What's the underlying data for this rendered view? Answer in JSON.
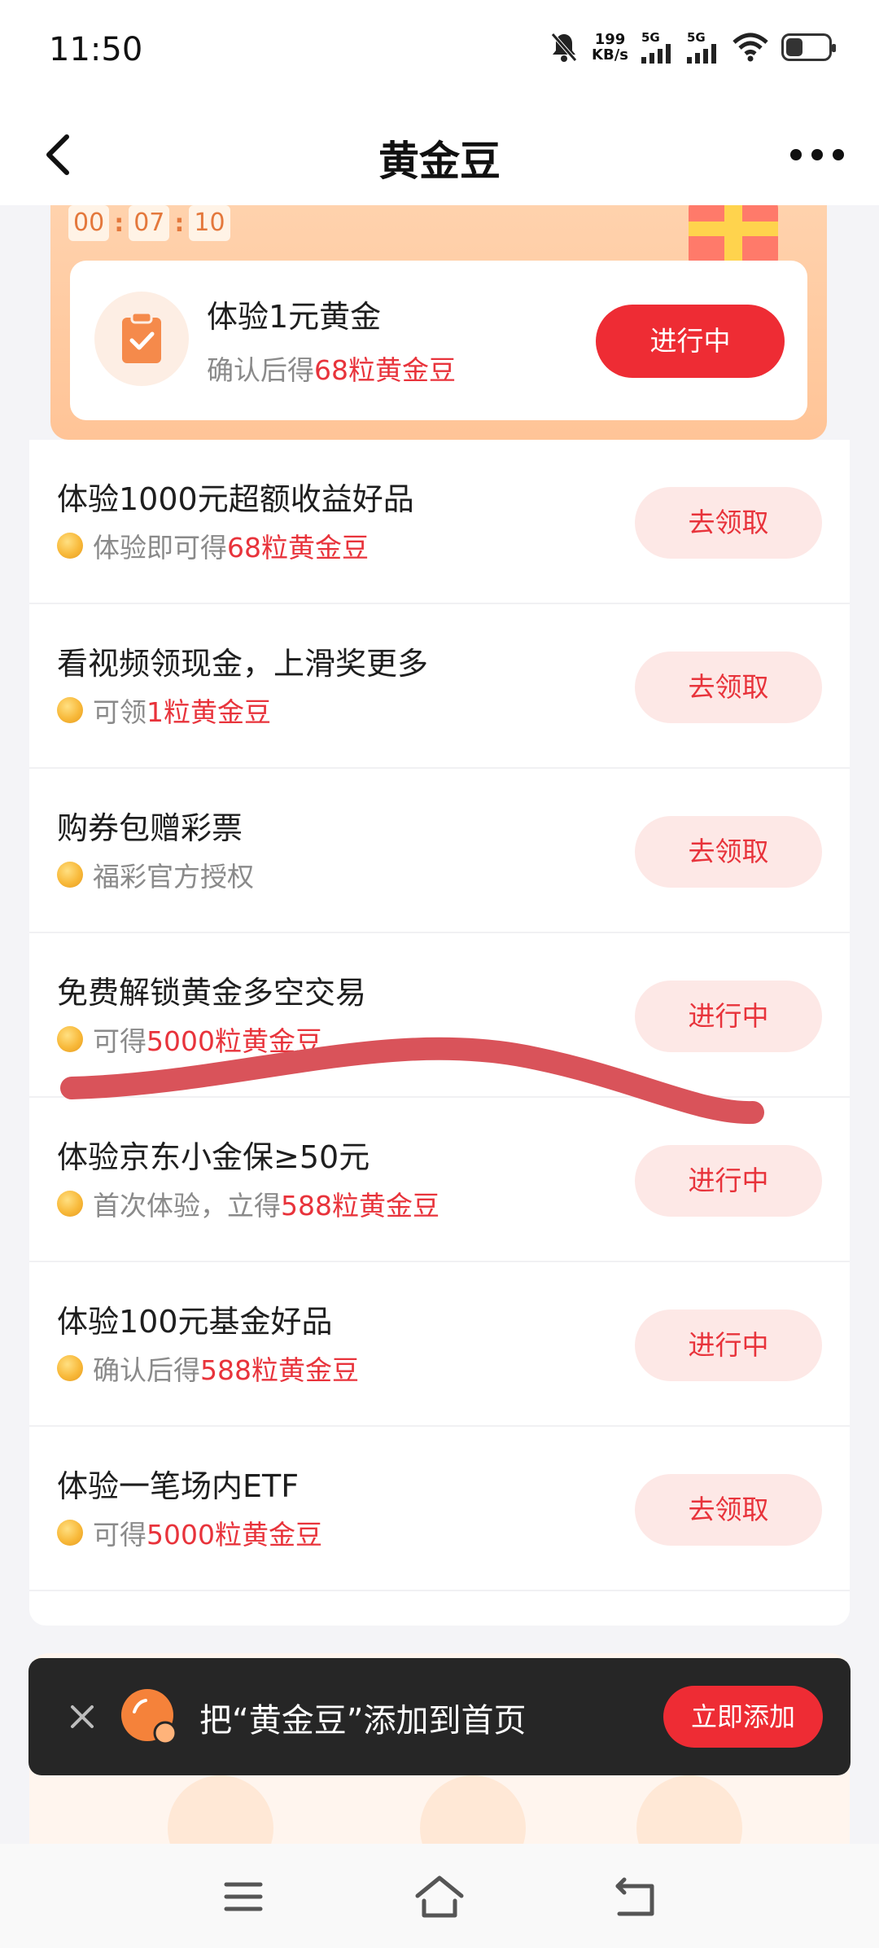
{
  "status_bar": {
    "time": "11:50",
    "net_speed_value": "199",
    "net_speed_unit": "KB/s",
    "sim1": "5G",
    "sim2": "5G",
    "icons": [
      "bell-muted-icon",
      "signal-icon",
      "signal-icon",
      "wifi-icon",
      "battery-icon"
    ]
  },
  "nav": {
    "title": "黄金豆",
    "back_icon": "chevron-left-icon",
    "more_icon": "more-dots-icon"
  },
  "promo": {
    "timer": [
      "00",
      "07",
      "10"
    ],
    "title": "体验1元黄金",
    "sub_prefix": "确认后得",
    "sub_highlight": "68粒黄金豆",
    "button": "进行中",
    "icon": "clipboard-check-icon"
  },
  "tasks": [
    {
      "title": "体验1000元超额收益好品",
      "sub_prefix": "体验即可得",
      "sub_highlight": "68粒黄金豆",
      "button": "去领取"
    },
    {
      "title": "看视频领现金，上滑奖更多",
      "sub_prefix": "可领",
      "sub_highlight": "1粒黄金豆",
      "button": "去领取"
    },
    {
      "title": "购券包赠彩票",
      "sub_prefix": "福彩官方授权",
      "sub_highlight": "",
      "button": "去领取"
    },
    {
      "title": "免费解锁黄金多空交易",
      "sub_prefix": "可得",
      "sub_highlight": "5000粒黄金豆",
      "button": "进行中"
    },
    {
      "title": "体验京东小金保≥50元",
      "sub_prefix": "首次体验，立得",
      "sub_highlight": "588粒黄金豆",
      "button": "进行中"
    },
    {
      "title": "体验100元基金好品",
      "sub_prefix": "确认后得",
      "sub_highlight": "588粒黄金豆",
      "button": "进行中"
    },
    {
      "title": "体验一笔场内ETF",
      "sub_prefix": "可得",
      "sub_highlight": "5000粒黄金豆",
      "button": "去领取"
    }
  ],
  "banner": {
    "text": "把“黄金豆”添加到首页",
    "button": "立即添加",
    "close_icon": "close-icon"
  },
  "system_nav": {
    "icons": [
      "menu-icon",
      "home-icon",
      "back-icon"
    ]
  },
  "colors": {
    "accent_red": "#ee2c34",
    "highlight_red": "#e8333b",
    "promo_orange": "#ffc497",
    "banner_dark": "#262626"
  }
}
